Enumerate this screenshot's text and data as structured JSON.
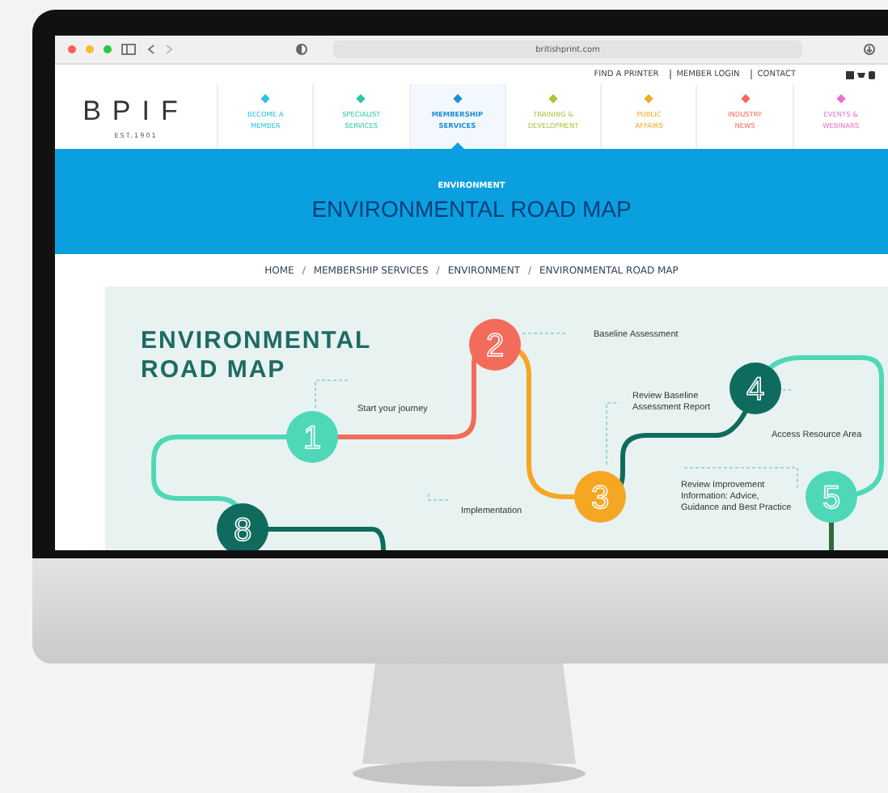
{
  "browser": {
    "url": "britishprint.com"
  },
  "top_links": [
    "FIND A PRINTER",
    "MEMBER LOGIN",
    "CONTACT"
  ],
  "logo": {
    "name": "BPIF",
    "est": "EST.1901"
  },
  "nav": [
    {
      "lines": [
        "BECOME A",
        "MEMBER"
      ],
      "color": "#29c4e0",
      "selected": false
    },
    {
      "lines": [
        "SPECIALIST",
        "SERVICES"
      ],
      "color": "#2ec4a6",
      "selected": false
    },
    {
      "lines": [
        "MEMBERSHIP",
        "SERVICES"
      ],
      "color": "#1a8fd6",
      "selected": true
    },
    {
      "lines": [
        "TRAINING &",
        "DEVELOPMENT"
      ],
      "color": "#a8c43a",
      "selected": false
    },
    {
      "lines": [
        "PUBLIC",
        "AFFAIRS"
      ],
      "color": "#f5a623",
      "selected": false
    },
    {
      "lines": [
        "INDUSTRY",
        "NEWS"
      ],
      "color": "#f2685a",
      "selected": false
    },
    {
      "lines": [
        "EVENTS &",
        "WEBINARS"
      ],
      "color": "#ec6fcf",
      "selected": false
    }
  ],
  "banner": {
    "kicker": "ENVIRONMENT",
    "title": "ENVIRONMENTAL ROAD MAP"
  },
  "breadcrumb": [
    {
      "label": "HOME"
    },
    {
      "separator": "/",
      "label": "MEMBERSHIP SERVICES"
    },
    {
      "separator": "/",
      "label": "ENVIRONMENT"
    },
    {
      "separator": "/",
      "label": "ENVIRONMENTAL ROAD MAP"
    }
  ],
  "map": {
    "title": [
      "ENVIRONMENTAL",
      "ROAD MAP"
    ],
    "steps": [
      {
        "number": "1",
        "color": "#4fd8b8"
      },
      {
        "number": "2",
        "color": "#f26b5b"
      },
      {
        "number": "3",
        "color": "#f5a623"
      },
      {
        "number": "4",
        "color": "#0f6b5e"
      },
      {
        "number": "5",
        "color": "#4fd8b8"
      },
      {
        "number": "8",
        "color": "#0f6b5e"
      }
    ],
    "labels": [
      {
        "lines": [
          "Start your journey"
        ]
      },
      {
        "lines": [
          "Baseline Assessment"
        ]
      },
      {
        "lines": [
          "Review Baseline",
          "Assessment Report"
        ]
      },
      {
        "lines": [
          "Access Resource Area"
        ]
      },
      {
        "lines": [
          "Review Improvement",
          "Information: Advice,",
          "Guidance and Best Practice"
        ]
      },
      {
        "lines": [
          "Implementation"
        ]
      }
    ]
  }
}
